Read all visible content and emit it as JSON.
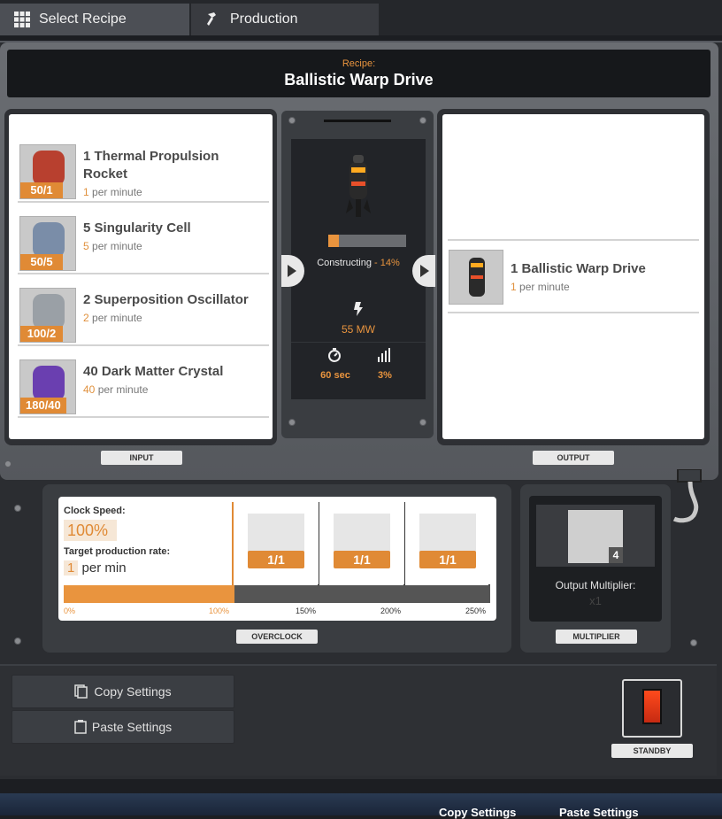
{
  "tabs": [
    {
      "label": "Select Recipe",
      "icon": "grid-icon"
    },
    {
      "label": "Production",
      "icon": "hammer-icon"
    }
  ],
  "recipe": {
    "label": "Recipe:",
    "name": "Ballistic Warp Drive"
  },
  "inputs": [
    {
      "qty": "1",
      "name": "Thermal Propulsion Rocket",
      "rate_n": "1",
      "rate_unit": " per minute",
      "badge": "50/1",
      "color": "#b8402f"
    },
    {
      "qty": "5",
      "name": "Singularity Cell",
      "rate_n": "5",
      "rate_unit": " per minute",
      "badge": "50/5",
      "color": "#7a8da8"
    },
    {
      "qty": "2",
      "name": "Superposition Oscillator",
      "rate_n": "2",
      "rate_unit": " per minute",
      "badge": "100/2",
      "color": "#9aa0a6"
    },
    {
      "qty": "40",
      "name": "Dark Matter Crystal",
      "rate_n": "40",
      "rate_unit": " per minute",
      "badge": "180/40",
      "color": "#6a3fb0"
    }
  ],
  "machine": {
    "status": "Constructing",
    "percent": "- 14%",
    "progress": 0.14,
    "power": "55 MW",
    "time": "60 sec",
    "efficiency": "3%"
  },
  "output": {
    "qty": "1",
    "name": "Ballistic Warp Drive",
    "rate_n": "1",
    "rate_unit": " per minute"
  },
  "tags": {
    "input": "INPUT",
    "output": "OUTPUT",
    "overclock": "OVERCLOCK",
    "multiplier": "MULTIPLIER",
    "standby": "STANDBY"
  },
  "overclock": {
    "clock_label": "Clock Speed:",
    "clock_value": "100%",
    "target_label": "Target production rate:",
    "target_n": "1",
    "target_unit": "per min",
    "slots": [
      "1/1",
      "1/1",
      "1/1"
    ],
    "scale": [
      "0%",
      "100%",
      "150%",
      "200%",
      "250%"
    ],
    "level": 0.4
  },
  "multiplier": {
    "count": "4",
    "label": "Output Multiplier:",
    "value": "x1"
  },
  "buttons": {
    "copy": "Copy Settings",
    "paste": "Paste Settings"
  },
  "footer": {
    "copy": "Copy Settings",
    "paste": "Paste Settings"
  }
}
